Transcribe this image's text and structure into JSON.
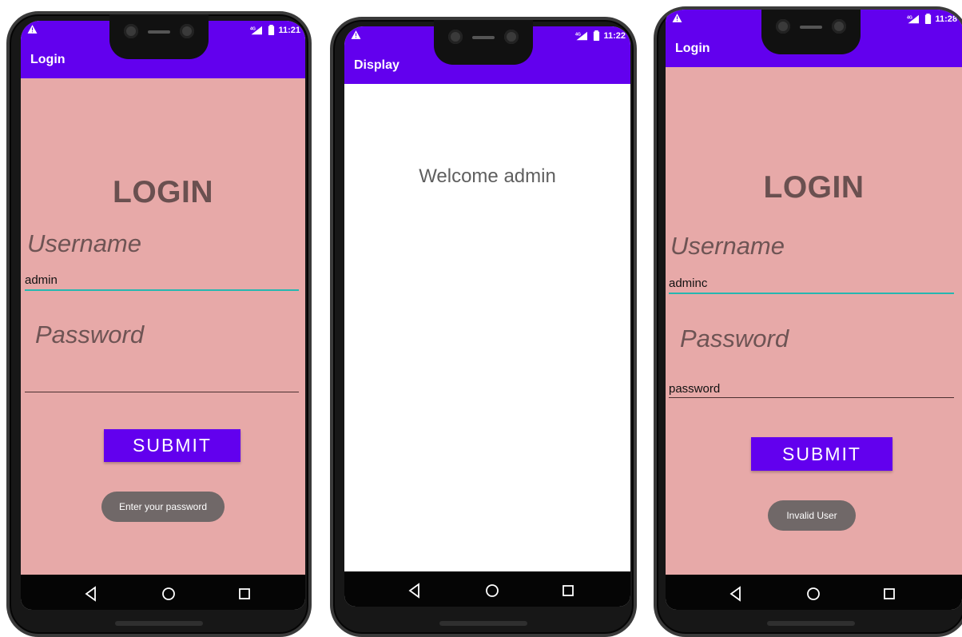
{
  "screens": [
    {
      "status_time": "11:21",
      "network": "4G",
      "app_title": "Login",
      "heading": "LOGIN",
      "username_label": "Username",
      "username_value": "admin",
      "password_label": "Password",
      "password_value": "",
      "submit_label": "SUBMIT",
      "toast": "Enter your password",
      "theme_color": "#6200ee",
      "background_color": "#e7a9a8"
    },
    {
      "status_time": "11:22",
      "network": "4G",
      "app_title": "Display",
      "welcome_text": "Welcome admin",
      "theme_color": "#6200ee",
      "background_color": "#ffffff"
    },
    {
      "status_time": "11:28",
      "network": "4G",
      "app_title": "Login",
      "heading": "LOGIN",
      "username_label": "Username",
      "username_value": "adminc",
      "password_label": "Password",
      "password_value": "password",
      "submit_label": "SUBMIT",
      "toast": "Invalid User",
      "theme_color": "#6200ee",
      "background_color": "#e7a9a8"
    }
  ],
  "navigation": {
    "back_icon": "back-triangle-icon",
    "home_icon": "home-circle-icon",
    "recent_icon": "recent-square-icon"
  },
  "status_icons": {
    "warning": "warning-triangle-icon",
    "signal": "signal-icon",
    "battery": "battery-icon"
  }
}
